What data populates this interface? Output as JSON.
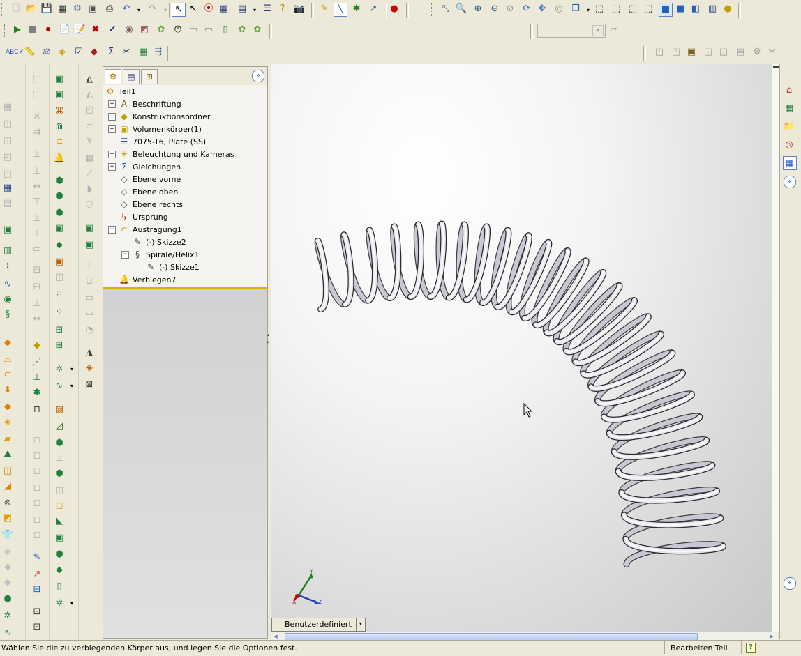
{
  "toolbar_rows": {
    "row1_icons": [
      "new-document-icon",
      "open-folder-icon",
      "save-icon",
      "print-preview-icon",
      "options-icon",
      "rebuild-icon",
      "print-icon",
      "undo-icon",
      "redo-icon",
      "select-icon",
      "select-other-icon",
      "traffic-light-icon",
      "grid-icon",
      "window-icon",
      "help-icon",
      "camera-icon",
      "sketch-icon",
      "line-icon",
      "point-icon",
      "smart-dim-icon",
      "record-icon",
      "zoom-fit-icon",
      "zoom-area-icon",
      "zoom-in-icon",
      "zoom-out-icon",
      "zoom-previous-icon",
      "rotate-icon",
      "pan-icon",
      "roll-icon",
      "view-orientation-icon",
      "wireframe-icon",
      "hidden-lines-icon",
      "hidden-removed-icon",
      "shaded-edges-icon",
      "shaded-icon",
      "perspective-icon",
      "section-icon",
      "realview-icon",
      "appearance-icon"
    ],
    "row2_icons": [
      "play-icon",
      "stop-icon",
      "record-macro-icon",
      "new-macro-icon",
      "edit-macro-icon",
      "delete-icon",
      "checkmark-icon",
      "mold-icon",
      "scale-icon",
      "parting-icon",
      "tooling-icon",
      "split-icon",
      "core-icon",
      "cavity-icon",
      "surface-icon"
    ],
    "row3_icons": [
      "spell-check-icon",
      "measure-icon",
      "mass-props-icon",
      "section-props-icon",
      "check-icon",
      "geometry-analysis-icon",
      "equation-icon",
      "draft-analysis-icon",
      "thickness-icon",
      "deviation-icon"
    ],
    "row3_right_icons": [
      "loft-icon",
      "boundary-icon",
      "sheet-metal-icon",
      "flatten-icon",
      "weld-icon",
      "hole-icon",
      "fillet-icon",
      "chamfer-icon"
    ]
  },
  "dropdown_config": {
    "value": ""
  },
  "feature_tree": {
    "tabs": [
      "featuremanager-tab",
      "propertymanager-tab",
      "configurationmanager-tab"
    ],
    "root": "Teil1",
    "items": [
      {
        "label": "Beschriftung",
        "icon": "annotation-icon",
        "expander": "+",
        "indent": 0
      },
      {
        "label": "Konstruktionsordner",
        "icon": "folder-diamond-icon",
        "expander": "+",
        "indent": 0
      },
      {
        "label": "Volumenkörper(1)",
        "icon": "solid-bodies-icon",
        "expander": "+",
        "indent": 0
      },
      {
        "label": "7075-T6, Plate (SS)",
        "icon": "material-icon",
        "expander": "",
        "indent": 0
      },
      {
        "label": "Beleuchtung und Kameras",
        "icon": "lights-icon",
        "expander": "+",
        "indent": 0
      },
      {
        "label": "Gleichungen",
        "icon": "equations-icon",
        "expander": "+",
        "indent": 0
      },
      {
        "label": "Ebene vorne",
        "icon": "plane-icon",
        "expander": "",
        "indent": 0
      },
      {
        "label": "Ebene oben",
        "icon": "plane-icon",
        "expander": "",
        "indent": 0
      },
      {
        "label": "Ebene rechts",
        "icon": "plane-icon",
        "expander": "",
        "indent": 0
      },
      {
        "label": "Ursprung",
        "icon": "origin-icon",
        "expander": "",
        "indent": 0
      },
      {
        "label": "Austragung1",
        "icon": "sweep-icon",
        "expander": "−",
        "indent": 0
      },
      {
        "label": "(-) Skizze2",
        "icon": "sketch-icon",
        "expander": "",
        "indent": 1
      },
      {
        "label": "Spirale/Helix1",
        "icon": "helix-icon",
        "expander": "−",
        "indent": 1
      },
      {
        "label": "(-) Skizze1",
        "icon": "sketch-icon",
        "expander": "",
        "indent": 2
      },
      {
        "label": "Verbiegen7",
        "icon": "flex-icon",
        "expander": "",
        "indent": 0
      }
    ]
  },
  "viewport": {
    "view_label": "Benutzerdefiniert",
    "triad": {
      "x": "X",
      "y": "Y",
      "z": "Z"
    },
    "coil_color": "#e8e8f0",
    "coil_edge": "#2a2a2a"
  },
  "right_taskpane_icons": [
    "home-icon",
    "design-library-icon",
    "file-explorer-icon",
    "search-icon",
    "appearances-icon",
    "custom-properties-icon",
    "collapse-icon"
  ],
  "status": {
    "message": "Wählen Sie die zu verbiegenden Körper aus, und legen Sie die Optionen fest.",
    "mode": "Bearbeiten Teil",
    "help": "?"
  },
  "colors": {
    "chrome": "#ece9d8",
    "accent": "#d8b000",
    "tree_bg": "#f5f4f0"
  }
}
